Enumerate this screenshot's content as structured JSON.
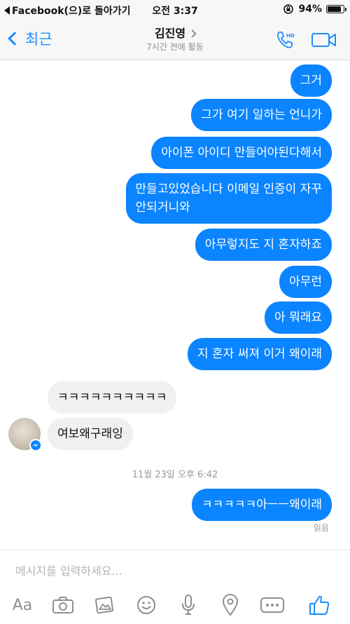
{
  "status_bar": {
    "back_app": "Facebook(으)로 돌아가기",
    "time": "오전 3:37",
    "battery": "94%",
    "battery_level": 0.94
  },
  "header": {
    "back_label": "최근",
    "contact_name": "김진영",
    "activity": "7시간 전에 활동",
    "call_icon": "phone-hd-icon",
    "video_icon": "video-camera-icon"
  },
  "messages": [
    {
      "side": "out",
      "text": "그거"
    },
    {
      "side": "out",
      "text": "그가 여기 일하는 언니가"
    },
    {
      "side": "out",
      "text": "아이폰 아이디 만들어야된다해서"
    },
    {
      "side": "out",
      "text": "만들고있었습니다 이메일 인증이 자꾸\n안되거니와"
    },
    {
      "side": "out",
      "text": "아무렇지도 지 혼자하죠"
    },
    {
      "side": "out",
      "text": "아무런"
    },
    {
      "side": "out",
      "text": "아 뭐래요"
    },
    {
      "side": "out",
      "text": "지 혼자 써져 이거 왜이래"
    },
    {
      "side": "in",
      "text": "ㅋㅋㅋㅋㅋㅋㅋㅋㅋㅋ"
    },
    {
      "side": "in",
      "text": "여보왜구래잉"
    },
    {
      "side": "out",
      "text": "ㅋㅋㅋㅋㅋ아ㅡㅡ왜이래"
    }
  ],
  "timestamp": "11월 23일 오후 6:42",
  "read_receipt": "읽음",
  "composer": {
    "placeholder": "메시지를 입력하세요...",
    "aa_label": "Aa"
  },
  "colors": {
    "accent": "#1a8cff",
    "outgoing_bubble": "#0a84ff",
    "incoming_bubble": "#f0f0f0"
  }
}
